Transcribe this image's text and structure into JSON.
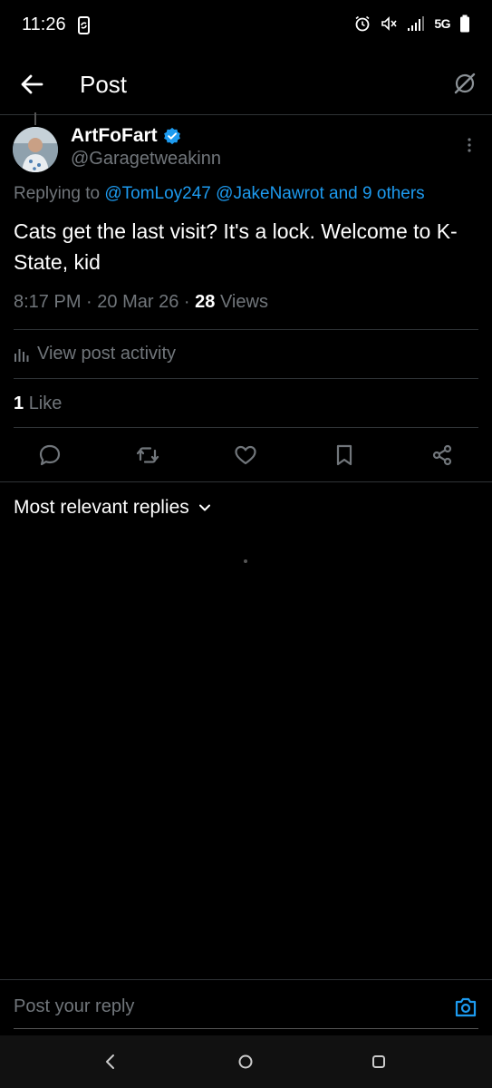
{
  "status_bar": {
    "time": "11:26",
    "network": "5G"
  },
  "header": {
    "title": "Post"
  },
  "post": {
    "author_name": "ArtFoFart",
    "author_handle": "@Garagetweakinn",
    "replying_prefix": "Replying to",
    "mention_1": "@TomLoy247",
    "mention_2": "@JakeNawrot",
    "mention_others": "and 9 others",
    "text": "Cats get the last visit? It's a lock. Welcome to K-State, kid",
    "time": "8:17 PM",
    "date": "20 Mar 26",
    "views_count": "28",
    "views_label": "Views",
    "activity_label": "View post activity",
    "like_count": "1",
    "like_label": "Like"
  },
  "replies": {
    "sort_label": "Most relevant replies"
  },
  "reply_bar": {
    "placeholder": "Post your reply"
  },
  "colors": {
    "accent": "#1d9bf0",
    "muted": "#71767b",
    "divider": "#2f3336",
    "background": "#000000"
  },
  "icons": {
    "back": "arrow-left-icon",
    "grok": "grok-icon",
    "verified": "verified-badge-icon",
    "more": "more-vertical-icon",
    "activity": "bar-chart-icon",
    "reply": "reply-icon",
    "repost": "repost-icon",
    "like": "heart-icon",
    "bookmark": "bookmark-icon",
    "share": "share-icon",
    "sort": "chevron-down-icon",
    "camera": "camera-icon"
  }
}
